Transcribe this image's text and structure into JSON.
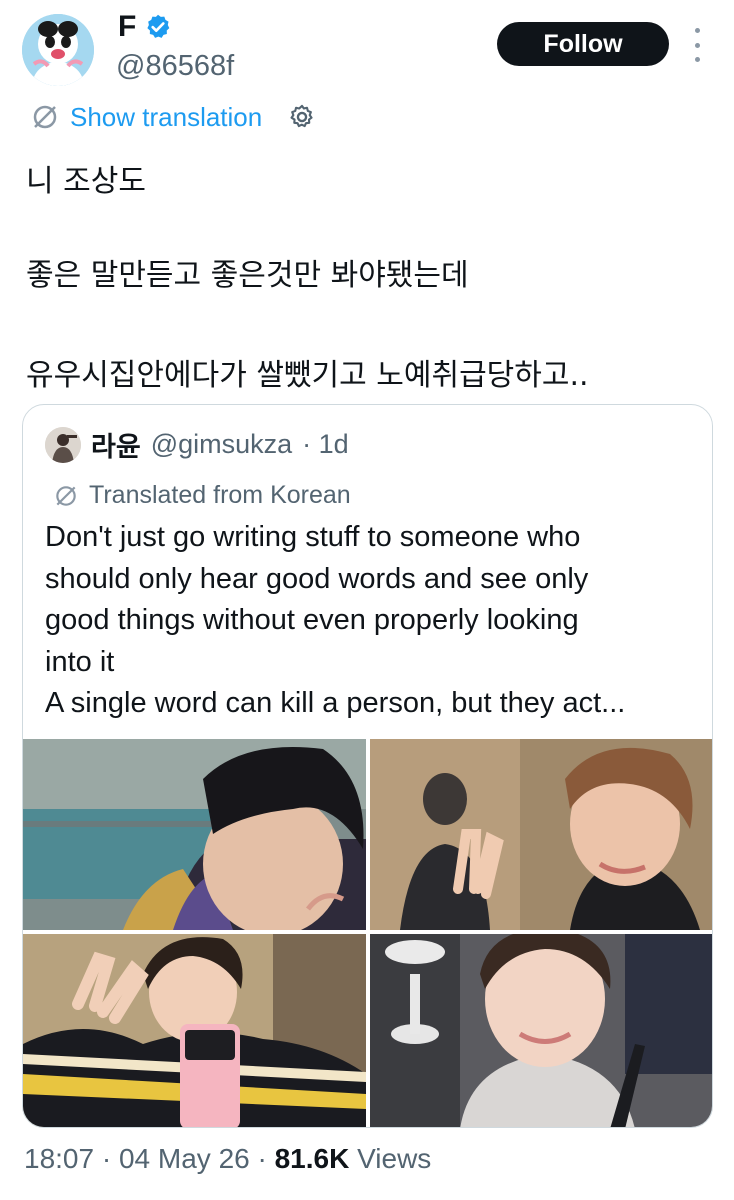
{
  "author": {
    "display_name": "F",
    "handle": "@86568f",
    "avatar_icon": "panda-avatar",
    "verified_color": "#1d9bf0"
  },
  "follow_label": "Follow",
  "show_translation": "Show translation",
  "tweet_lines": [
    "니 조상도",
    "좋은 말만듣고 좋은것만 봐야됐는데",
    "유우시집안에다가 쌀뺐기고 노예취급당하고.."
  ],
  "quote": {
    "name": "라윤",
    "handle": "@gimsukza",
    "time": "· 1d",
    "translated_label": "Translated from Korean",
    "body_lines": [
      "Don't just go writing stuff to someone who",
      "should only hear good words and see only",
      "good things without even properly looking",
      "into it",
      "A single word can kill a person, but they act..."
    ],
    "photos": [
      "photo-1",
      "photo-2",
      "photo-3",
      "photo-4"
    ]
  },
  "footer": {
    "time": "18:07",
    "sep1": " · ",
    "date": "04 May 26",
    "sep2": " · ",
    "views_count": "81.6K",
    "views_label": " Views"
  },
  "colors": {
    "accent": "#1d9bf0",
    "text": "#0f1419",
    "secondary": "#536471",
    "border": "#cfd9de"
  }
}
